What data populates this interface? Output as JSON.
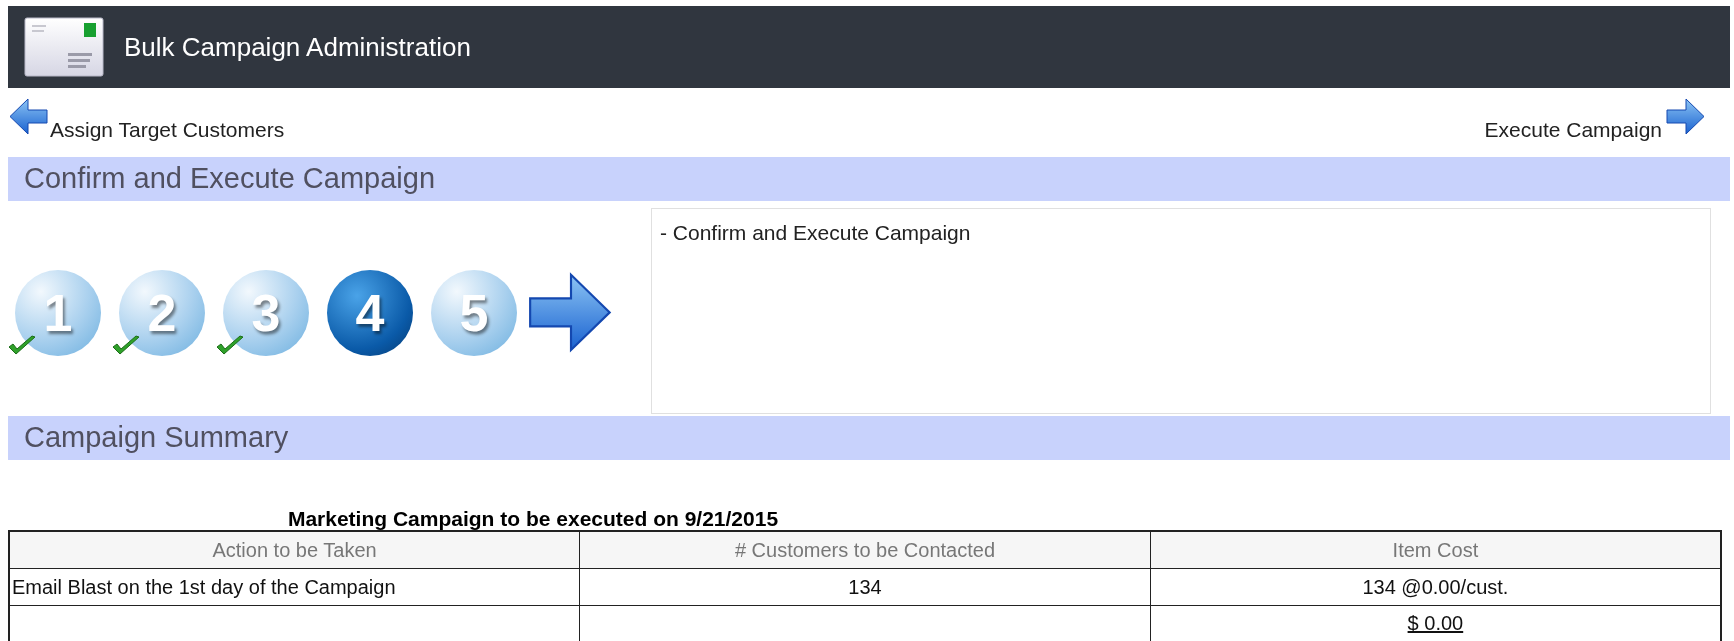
{
  "header": {
    "title": "Bulk Campaign Administration"
  },
  "nav": {
    "back": "Assign Target Customers",
    "next": "Execute Campaign"
  },
  "step_section": {
    "title": "Confirm and Execute Campaign",
    "steps": [
      {
        "label": "1",
        "completed": true,
        "selected": false
      },
      {
        "label": "2",
        "completed": true,
        "selected": false
      },
      {
        "label": "3",
        "completed": true,
        "selected": false
      },
      {
        "label": "4",
        "completed": false,
        "selected": true
      },
      {
        "label": "5",
        "completed": false,
        "selected": false
      }
    ],
    "description": "- Confirm and Execute Campaign"
  },
  "summary": {
    "title": "Campaign Summary",
    "table_title": "Marketing Campaign to be executed on 9/21/2015",
    "columns": [
      "Action to be Taken",
      "# Customers to be Contacted",
      "Item Cost"
    ],
    "rows": [
      {
        "cells": [
          "Email Blast on the 1st day of the Campaign",
          "134",
          "134 @0.00/cust."
        ]
      },
      {
        "cells": [
          "",
          "",
          "$ 0.00"
        ],
        "kind": "total"
      }
    ]
  }
}
